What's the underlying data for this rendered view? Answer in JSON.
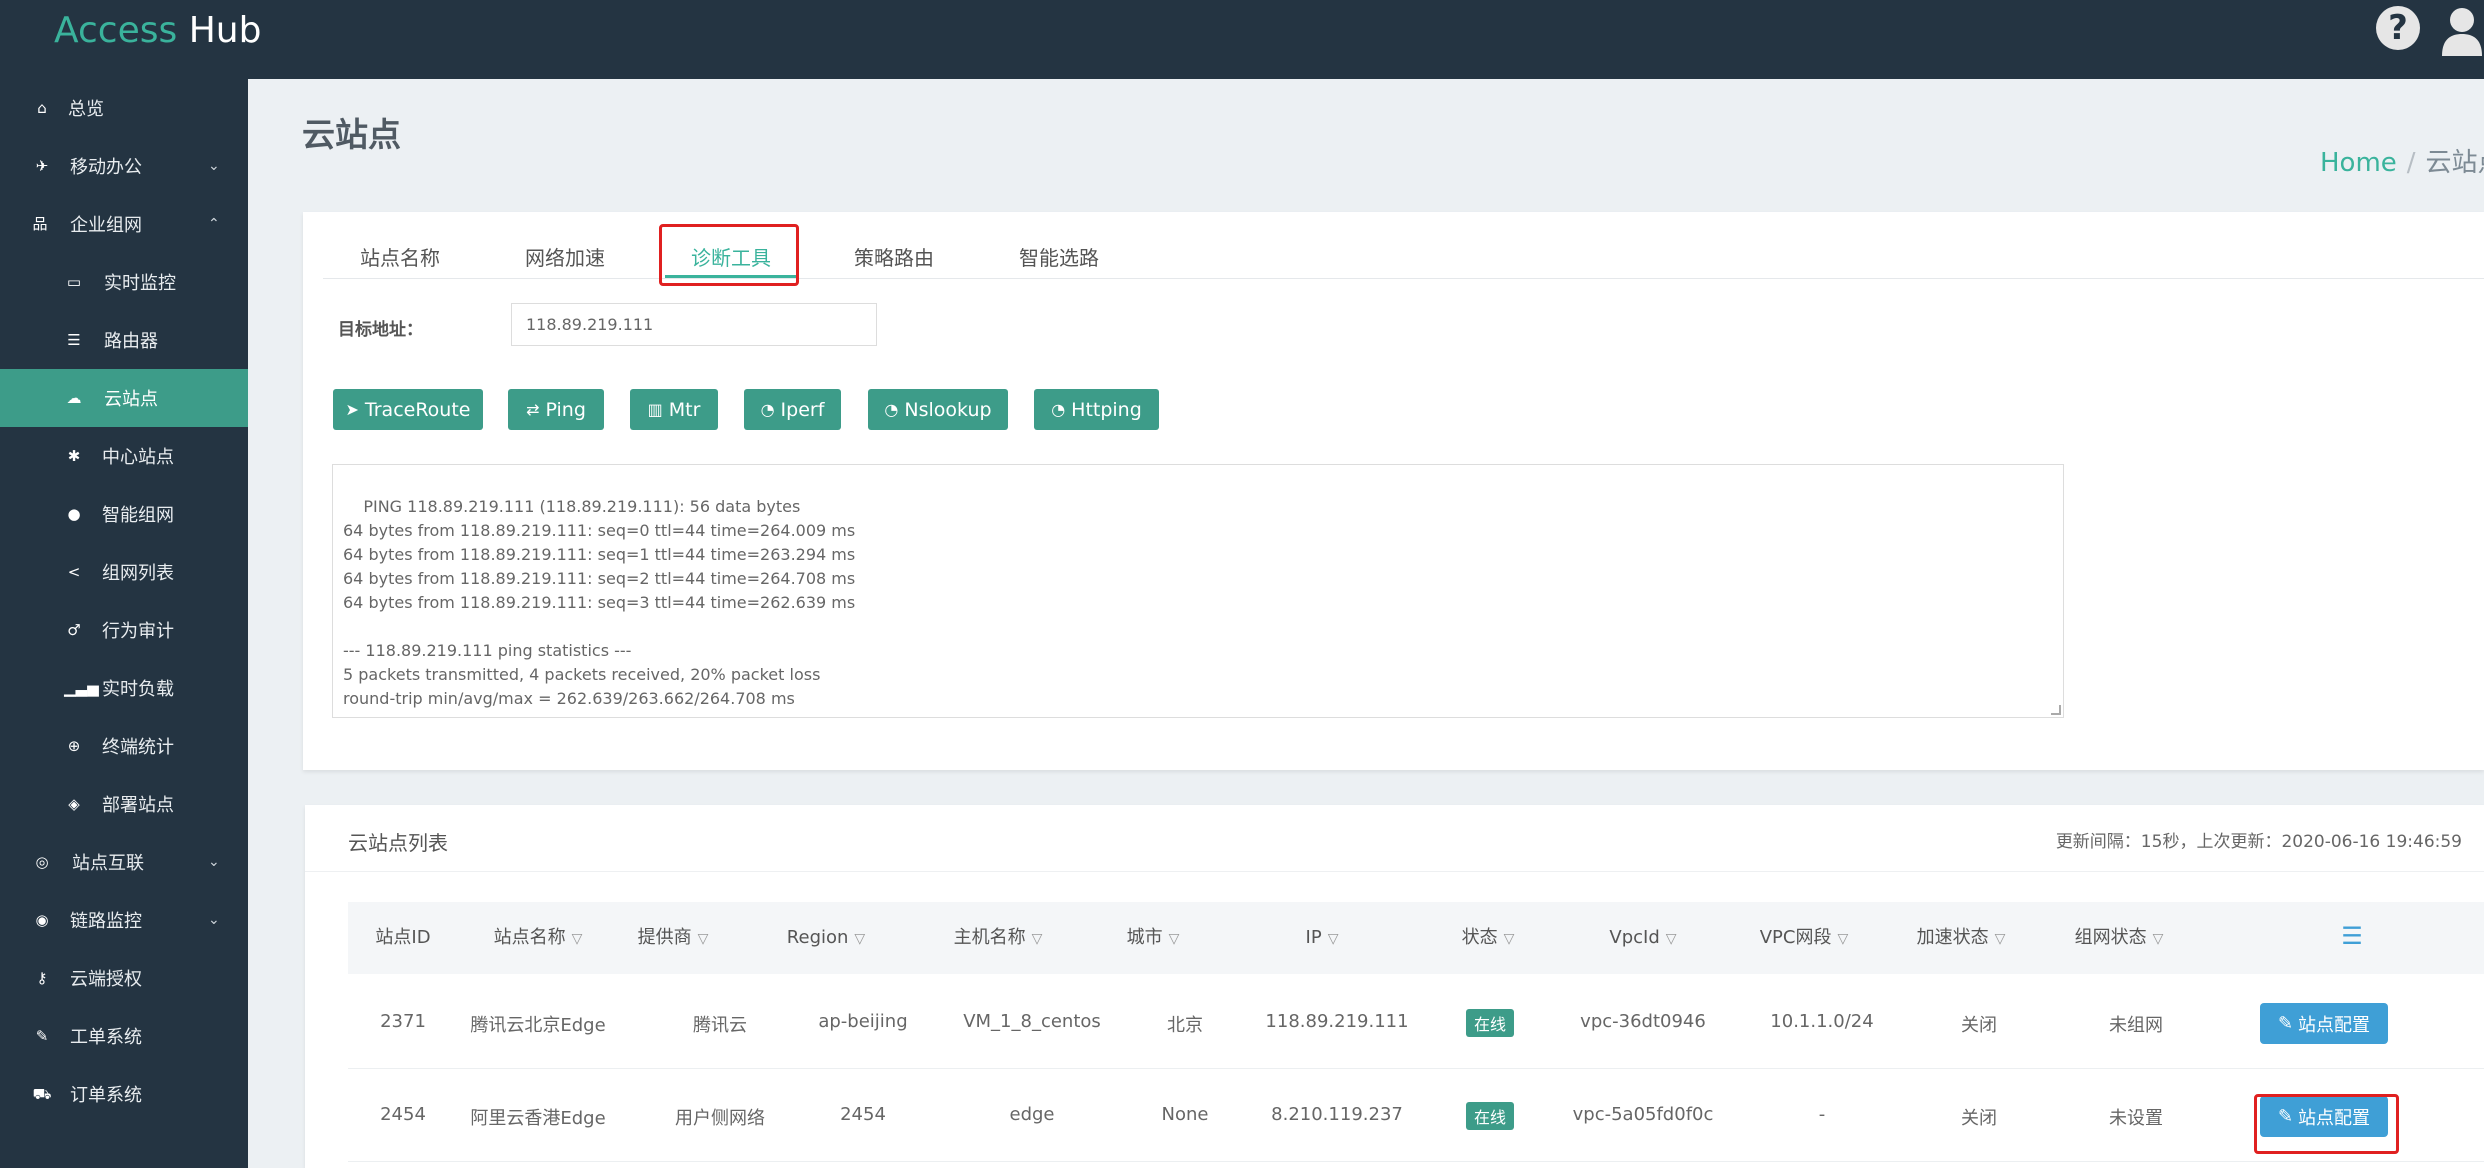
{
  "app": {
    "logo_part1": "Access",
    "logo_part2": "Hub"
  },
  "sidebar": {
    "items": [
      {
        "label": "总览",
        "icon": "home-icon"
      },
      {
        "label": "移动办公",
        "icon": "plane-icon"
      },
      {
        "label": "企业组网",
        "icon": "sitemap-icon"
      },
      {
        "label": "实时监控",
        "icon": "monitor-icon"
      },
      {
        "label": "路由器",
        "icon": "router-icon"
      },
      {
        "label": "云站点",
        "icon": "cloud-icon"
      },
      {
        "label": "中心站点",
        "icon": "asterisk-icon"
      },
      {
        "label": "智能组网",
        "icon": "lock-icon"
      },
      {
        "label": "组网列表",
        "icon": "share-icon"
      },
      {
        "label": "行为审计",
        "icon": "audit-icon"
      },
      {
        "label": "实时负载",
        "icon": "signal-icon"
      },
      {
        "label": "终端统计",
        "icon": "search-plus-icon"
      },
      {
        "label": "部署站点",
        "icon": "cube-icon"
      },
      {
        "label": "站点互联",
        "icon": "globe-icon"
      },
      {
        "label": "链路监控",
        "icon": "dashboard-icon"
      },
      {
        "label": "云端授权",
        "icon": "key-icon"
      },
      {
        "label": "工单系统",
        "icon": "wrench-icon"
      },
      {
        "label": "订单系统",
        "icon": "cart-icon"
      }
    ]
  },
  "page": {
    "title": "云站点"
  },
  "breadcrumb": {
    "home": "Home",
    "sep": "/",
    "current": "云站点"
  },
  "tabs": [
    "站点名称",
    "网络加速",
    "诊断工具",
    "策略路由",
    "智能选路"
  ],
  "diag": {
    "target_label": "目标地址：",
    "target_value": "118.89.219.111",
    "buttons": [
      "TraceRoute",
      "Ping",
      "Mtr",
      "Iperf",
      "Nslookup",
      "Httping"
    ],
    "output": "PING 118.89.219.111 (118.89.219.111): 56 data bytes\n64 bytes from 118.89.219.111: seq=0 ttl=44 time=264.009 ms\n64 bytes from 118.89.219.111: seq=1 ttl=44 time=263.294 ms\n64 bytes from 118.89.219.111: seq=2 ttl=44 time=264.708 ms\n64 bytes from 118.89.219.111: seq=3 ttl=44 time=262.639 ms\n\n--- 118.89.219.111 ping statistics ---\n5 packets transmitted, 4 packets received, 20% packet loss\nround-trip min/avg/max = 262.639/263.662/264.708 ms"
  },
  "list": {
    "title": "云站点列表",
    "update_info": "更新间隔：15秒，上次更新：2020-06-16 19:46:59",
    "columns": [
      "站点ID",
      "站点名称",
      "提供商",
      "Region",
      "主机名称",
      "城市",
      "IP",
      "状态",
      "VpcId",
      "VPC网段",
      "加速状态",
      "组网状态"
    ],
    "rows": [
      [
        "2371",
        "腾讯云北京Edge",
        "腾讯云",
        "ap-beijing",
        "VM_1_8_centos",
        "北京",
        "118.89.219.111",
        "在线",
        "vpc-36dt0946",
        "10.1.1.0/24",
        "关闭",
        "未组网"
      ],
      [
        "2454",
        "阿里云香港Edge",
        "用户侧网络",
        "2454",
        "edge",
        "None",
        "8.210.119.237",
        "在线",
        "vpc-5a05fd0f0c",
        "-",
        "关闭",
        "未设置"
      ]
    ],
    "config_button": "站点配置"
  }
}
